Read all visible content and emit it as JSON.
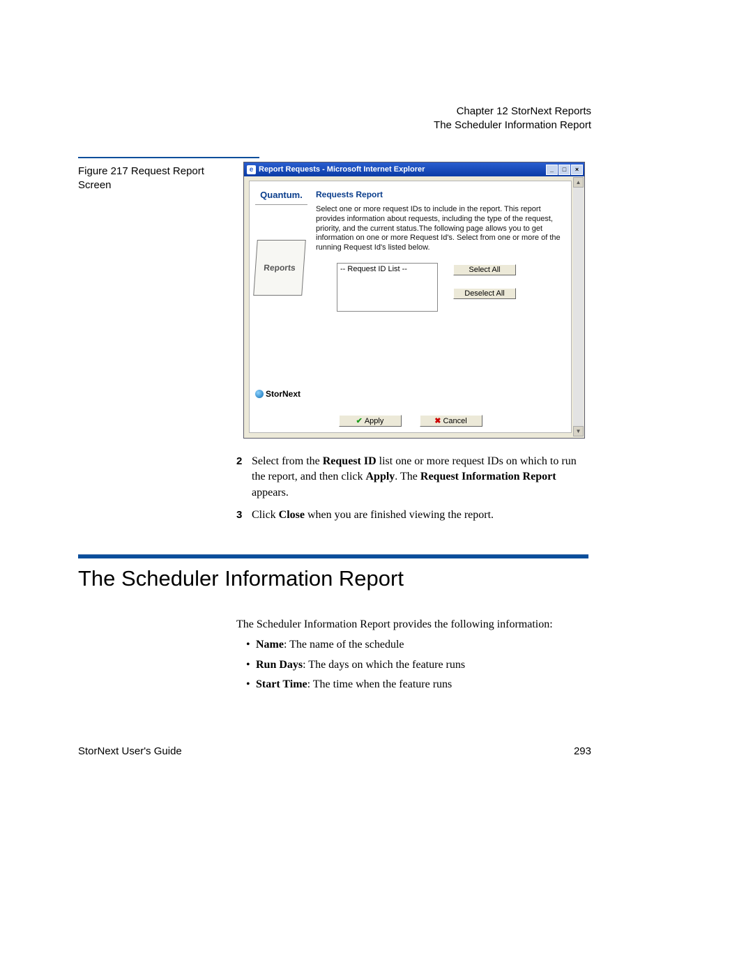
{
  "header": {
    "chapter": "Chapter 12  StorNext Reports",
    "section": "The Scheduler Information Report"
  },
  "figure": {
    "caption": "Figure 217  Request Report Screen"
  },
  "window": {
    "title": "Report Requests - Microsoft Internet Explorer",
    "brand": "Quantum.",
    "sidebar_box": "Reports",
    "product": "StorNext",
    "panel_title": "Requests Report",
    "panel_desc": "Select one or more request IDs to include in the report. This report provides information about requests, including the type of the request, priority, and the current status.The following page allows you to get information on one or more Request Id's. Select from one or more of the running Request Id's listed below.",
    "list_placeholder": "-- Request ID List --",
    "buttons": {
      "select_all": "Select All",
      "deselect_all": "Deselect All",
      "apply": "Apply",
      "cancel": "Cancel"
    }
  },
  "steps": {
    "s2_num": "2",
    "s2_a": "Select from the ",
    "s2_b": "Request ID",
    "s2_c": " list one or more request IDs on which to run the report, and then click ",
    "s2_d": "Apply",
    "s2_e": ". The ",
    "s2_f": "Request Information Report",
    "s2_g": " appears.",
    "s3_num": "3",
    "s3_a": "Click ",
    "s3_b": "Close",
    "s3_c": " when you are finished viewing the report."
  },
  "section": {
    "title": "The Scheduler Information Report",
    "intro": "The Scheduler Information Report provides the following information:",
    "bullets": {
      "b1_label": "Name",
      "b1_text": ": The name of the schedule",
      "b2_label": "Run Days",
      "b2_text": ": The days on which the feature runs",
      "b3_label": "Start Time",
      "b3_text": ": The time when the feature runs"
    }
  },
  "footer": {
    "left": "StorNext User's Guide",
    "right": "293"
  }
}
